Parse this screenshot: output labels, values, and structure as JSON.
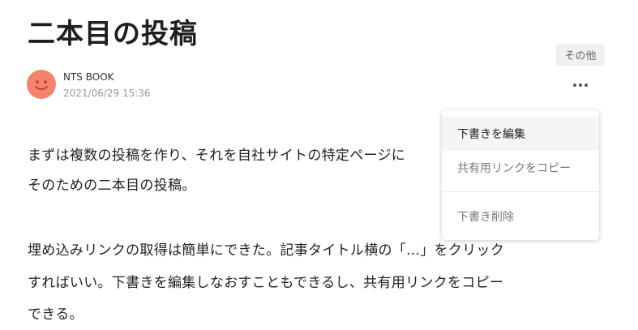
{
  "post": {
    "title": "二本目の投稿",
    "author": "NTS BOOK",
    "date": "2021/06/29 15:36",
    "paragraphs": [
      "まずは複数の投稿を作り、それを自社サイトの特定ページに",
      "そのための二本目の投稿。",
      "埋め込みリンクの取得は簡単にできた。記事タイトル横の「...」をクリック",
      "すればいい。下書きを編集しなおすこともできるし、共有用リンクをコピー",
      "できる。"
    ]
  },
  "tooltip": {
    "label": "その他"
  },
  "menu": {
    "items": [
      "下書きを編集",
      "共有用リンクをコピー",
      "下書き削除"
    ]
  },
  "colors": {
    "avatar": "#f4836e",
    "menu_hover": "#f5f5f5"
  },
  "icons": {
    "more": "more-horizontal-icon",
    "avatar": "smiley-avatar"
  }
}
